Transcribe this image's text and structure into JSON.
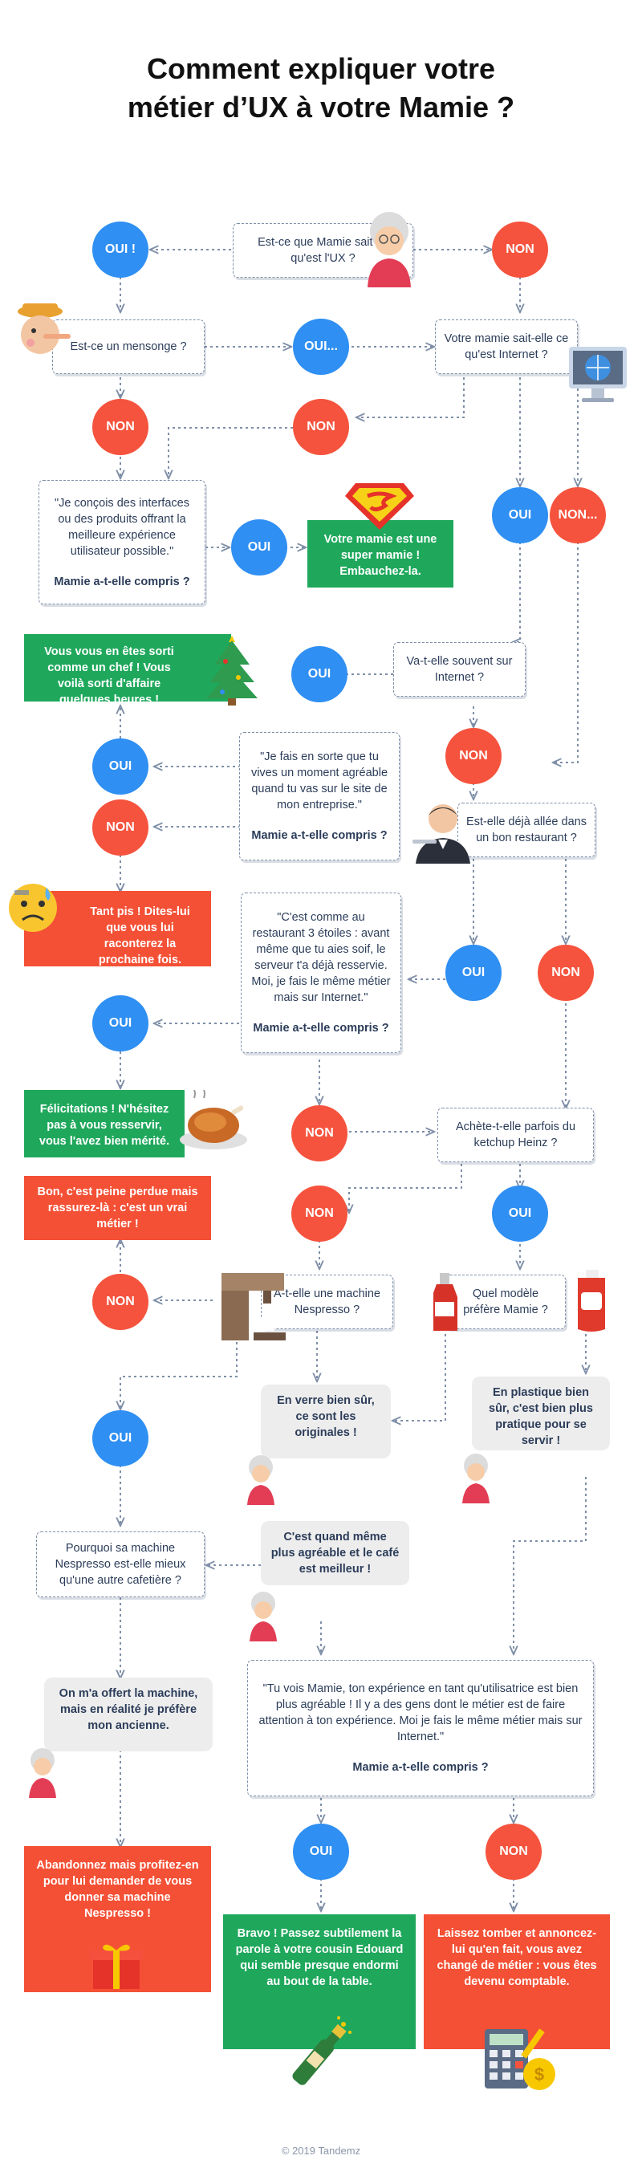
{
  "title": {
    "line1": "Comment expliquer votre",
    "line2": "métier d’UX à votre Mamie ?"
  },
  "questions": {
    "q1": "Est-ce que Mamie sait ce qu'est l'UX ?",
    "q2": "Est-ce un mensonge ?",
    "q3": "Votre mamie sait-elle ce qu'est Internet ?",
    "q4": "\"Je conçois des interfaces ou des produits offrant la meilleure expérience utilisateur possible.\"",
    "q4_sub": "Mamie a-t-elle compris ?",
    "q5": "Va-t-elle souvent sur Internet ?",
    "q6": "\"Je fais en sorte que tu vives un moment agréable quand tu vas sur le site de mon entreprise.\"",
    "q6_sub": "Mamie a-t-elle compris ?",
    "q7": "Est-elle déjà allée dans un bon restaurant ?",
    "q8": "\"C'est comme au restaurant 3 étoiles : avant même que tu aies soif, le serveur t'a déjà resservie. Moi, je fais le même métier mais sur Internet.\"",
    "q8_sub": "Mamie a-t-elle compris ?",
    "q9": "Achète-t-elle parfois du ketchup Heinz ?",
    "q10": "A-t-elle une machine Nespresso ?",
    "q11": "Quel modèle préfère Mamie ?",
    "q12": "Pourquoi sa machine Nespresso est-elle mieux qu'une autre cafetière ?",
    "q13": "\"Tu vois Mamie,  ton expérience en tant qu'utilisatrice est bien plus agréable ! Il y a des gens dont le métier est de faire attention à ton expérience. Moi je fais le même métier mais sur Internet.\"",
    "q13_sub": "Mamie a-t-elle compris ?"
  },
  "answers": {
    "oui": "OUI",
    "oui_bang": "OUI !",
    "oui_dots": "OUI...",
    "non": "NON",
    "non_dots": "NON..."
  },
  "results": {
    "super_mamie": "Votre mamie est une super mamie ! Embauchez-la.",
    "chef": "Vous vous en êtes sorti comme un chef ! Vous voilà sorti d'affaire quelques heures !",
    "tant_pis": "Tant pis ! Dites-lui que vous lui raconterez la prochaine fois.",
    "felicitations": "Félicitations ! N'hésitez pas à vous resservir, vous l'avez bien mérité.",
    "peine_perdue": "Bon, c'est peine perdue mais rassurez-là : c'est un vrai métier !",
    "abandonnez": "Abandonnez mais profitez-en pour lui demander de vous donner sa machine Nespresso !",
    "bravo": "Bravo !  Passez subtilement la parole à votre cousin Edouard qui semble presque endormi au bout de la table.",
    "laissez_tomber": "Laissez tomber et annoncez-lui qu'en fait, vous avez changé de métier : vous êtes devenu comptable."
  },
  "bubbles": {
    "verre": "En verre bien sûr, ce sont les originales !",
    "plastique": "En plastique bien sûr, c'est bien plus pratique pour se servir !",
    "agreable": "C'est quand même plus agréable et le café est meilleur !",
    "offert": "On m'a offert la machine, mais en réalité je préfère mon ancienne."
  },
  "icons": [
    "grandma-icon",
    "pinocchio-icon",
    "computer-icon",
    "superman-logo-icon",
    "christmas-tree-icon",
    "waiter-icon",
    "sad-face-icon",
    "roast-turkey-icon",
    "coffee-machine-icon",
    "ketchup-bottles-icon",
    "gift-icon",
    "champagne-icon",
    "calculator-icon"
  ],
  "colors": {
    "oui": "#2f8ff2",
    "non": "#f5533d",
    "green": "#1fa85c",
    "red": "#f45035",
    "bubble": "#ededed",
    "line": "#7f8fa8"
  },
  "footer": "© 2019 Tandemz"
}
